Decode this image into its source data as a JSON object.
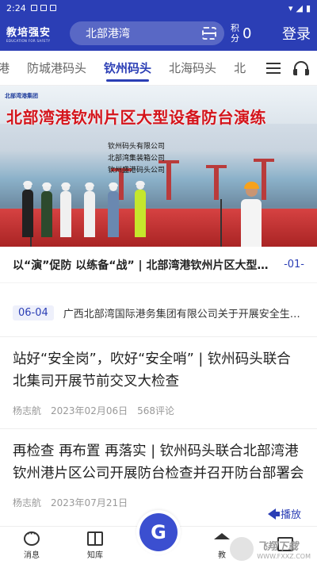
{
  "status_bar": {
    "time": "2:24"
  },
  "header": {
    "logo_title": "教培强安",
    "logo_sub": "EDUCATION FOR SAFETY",
    "search_value": "北部港湾",
    "points_label": "积分",
    "points_value": "0",
    "login_label": "登录"
  },
  "tabs": [
    "港",
    "防城港码头",
    "钦州码头",
    "北海码头",
    "北"
  ],
  "active_tab": "钦州码头",
  "banner": {
    "logo_text": "北部湾港集团",
    "headline": "北部湾港钦州片区大型设备防台演练",
    "companies": [
      "钦州码头有限公司",
      "北部湾集装箱公司",
      "钦州盛港码头公司"
    ]
  },
  "carousel": {
    "caption": "以“演”促防 以练备“战” | 北部湾港钦州片区大型设备防台演练",
    "index": "-01-"
  },
  "notice": {
    "date": "06-04",
    "title": "广西北部湾国际港务集团有限公司关于开展安全生产月活动的通知"
  },
  "articles": [
    {
      "title": "站好“安全岗”，吹好“安全哨” | 钦州码头联合北集司开展节前交叉大检查",
      "author": "杨志航",
      "date": "2023年02月06日",
      "comments": "568评论"
    },
    {
      "title": "再检查 再布置 再落实 | 钦州码头联合北部湾港钦州港片区公司开展防台检查并召开防台部署会",
      "author": "杨志航",
      "date": "2023年07月21日",
      "comments": ""
    }
  ],
  "play_label": "播放",
  "bottom_nav": {
    "messages": "消息",
    "knowledge": "知库",
    "fab": "G",
    "education": "教",
    "calendar": ""
  },
  "watermark": {
    "text": "飞翔下载",
    "url": "WWW.FXXZ.COM"
  },
  "colors": {
    "brand": "#2b3eb5",
    "accent_red": "#d4141b"
  }
}
